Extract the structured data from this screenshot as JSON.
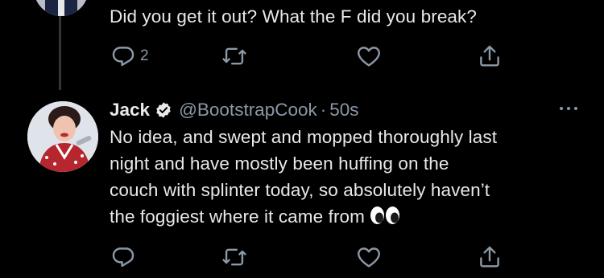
{
  "previous_tweet": {
    "text": "Did you get it out? What the F did you break?",
    "actions": {
      "reply_count": "2",
      "retweet_count": "",
      "like_count": ""
    }
  },
  "reply_tweet": {
    "author_name": "Jack",
    "handle": "@BootstrapCook",
    "separator": "·",
    "time": "50s",
    "text": "No idea, and swept and mopped thoroughly last\nnight and have mostly been huffing on the\ncouch with splinter today, so absolutely haven’t\nthe foggiest where it came from",
    "emoji": "eyes-emoji",
    "actions": {
      "reply_count": "",
      "retweet_count": "",
      "like_count": ""
    }
  },
  "icons": {
    "reply": "reply-icon",
    "retweet": "retweet-icon",
    "like": "heart-icon",
    "share": "share-icon",
    "verified": "verified-badge-icon",
    "more": "more-options-icon"
  },
  "colors": {
    "background": "#000000",
    "primary_text": "#e7e9ea",
    "secondary_text": "#8b98a5",
    "thread_line": "#333639"
  }
}
